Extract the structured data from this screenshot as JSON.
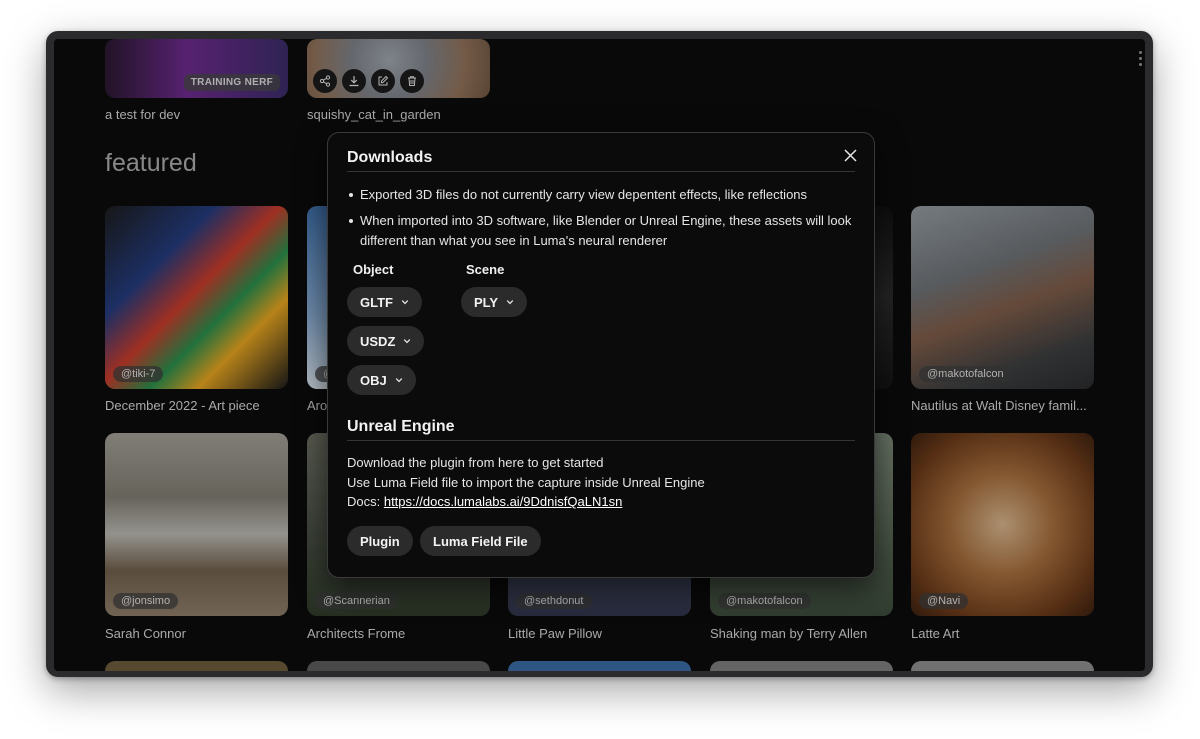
{
  "top_row": [
    {
      "caption": "a test for dev",
      "badge": "TRAINING NERF"
    },
    {
      "caption": "squishy_cat_in_garden",
      "actions": [
        "share-icon",
        "download-icon",
        "edit-icon",
        "trash-icon"
      ]
    }
  ],
  "section_title": "featured",
  "featured": [
    {
      "caption": "December 2022 - Art piece",
      "user": "@tiki-7"
    },
    {
      "caption": "Aro",
      "user": "@"
    },
    {
      "caption": "",
      "user": ""
    },
    {
      "caption": "",
      "user": ""
    },
    {
      "caption": "Nautilus at Walt Disney famil...",
      "user": "@makotofalcon"
    },
    {
      "caption": "Sarah Connor",
      "user": "@jonsimo"
    },
    {
      "caption": "Architects Frome",
      "user": "@Scannerian"
    },
    {
      "caption": "Little Paw Pillow",
      "user": "@sethdonut"
    },
    {
      "caption": "Shaking man by Terry Allen",
      "user": "@makotofalcon"
    },
    {
      "caption": "Latte Art",
      "user": "@Navi"
    }
  ],
  "modal": {
    "title": "Downloads",
    "notes": [
      "Exported 3D files do not currently carry view depentent effects, like reflections",
      "When imported into 3D software, like Blender or Unreal Engine, these assets will look different than what you see in Luma's neural renderer"
    ],
    "object_label": "Object",
    "scene_label": "Scene",
    "object_formats": [
      "GLTF",
      "USDZ",
      "OBJ"
    ],
    "scene_formats": [
      "PLY"
    ],
    "ue_title": "Unreal Engine",
    "ue_line1": "Download the plugin from here to get started",
    "ue_line2": "Use Luma Field file to import the capture inside Unreal Engine",
    "docs_label": "Docs: ",
    "docs_url": "https://docs.lumalabs.ai/9DdnisfQaLN1sn",
    "plugin_button": "Plugin",
    "field_button": "Luma Field File"
  }
}
